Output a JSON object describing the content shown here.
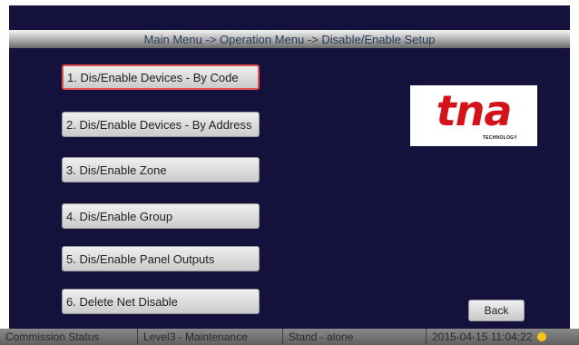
{
  "title": "Main Menu -> Operation Menu -> Disable/Enable Setup",
  "menu": {
    "items": [
      {
        "label": "1. Dis/Enable Devices - By Code",
        "selected": true
      },
      {
        "label": "2. Dis/Enable Devices - By Address",
        "selected": false
      },
      {
        "label": "3. Dis/Enable Zone",
        "selected": false
      },
      {
        "label": "4. Dis/Enable Group",
        "selected": false
      },
      {
        "label": "5. Dis/Enable Panel Outputs",
        "selected": false
      },
      {
        "label": "6. Delete Net Disable",
        "selected": false
      }
    ]
  },
  "logo": {
    "text": "tna",
    "subtext": "TECHNOLOGY"
  },
  "back_label": "Back",
  "status": {
    "commission": "Commission Status",
    "level": "Level3 - Maintenance",
    "mode": "Stand - alone",
    "datetime": "2015-04-15 11:04:22",
    "indicator_color": "#f5c518"
  },
  "colors": {
    "background": "#14123d",
    "selected_border": "#e05050",
    "logo_red": "#d3121b"
  }
}
